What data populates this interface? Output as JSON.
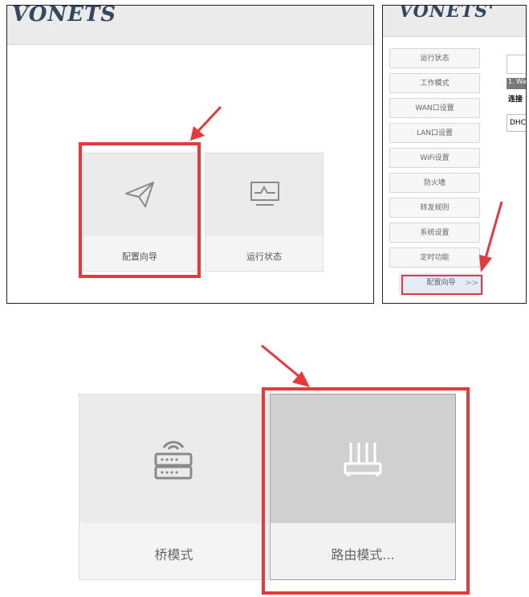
{
  "panel1": {
    "logo": "VONETS",
    "tiles": [
      {
        "label": "配置向导",
        "icon": "paper-plane-icon"
      },
      {
        "label": "运行状态",
        "icon": "monitor-icon"
      }
    ]
  },
  "panel2": {
    "logo": "VONETS'",
    "nav": [
      "运行状态",
      "工作模式",
      "WAN口设置",
      "LAN口设置",
      "WiFi设置",
      "防火墙",
      "转发规则",
      "系统设置",
      "定时功能",
      "配置向导"
    ],
    "active_chevron": ">>",
    "content": {
      "section": "1. Wa",
      "label": "连接",
      "value": "DHC"
    }
  },
  "panel3": {
    "tiles": [
      {
        "label": "桥模式",
        "icon": "router-stack-icon"
      },
      {
        "label": "路由模式...",
        "icon": "wireless-router-icon"
      }
    ]
  },
  "colors": {
    "highlight": "#e8383b",
    "tile_bg": "#ebebeb",
    "selected_bg": "#d0d0d0"
  }
}
